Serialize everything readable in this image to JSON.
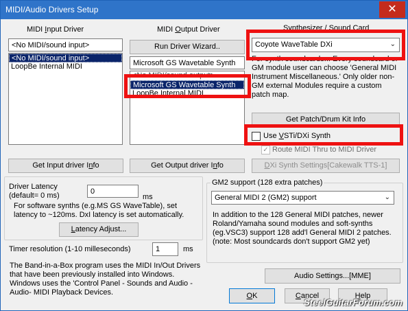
{
  "window": {
    "title": "MIDI/Audio Drivers Setup",
    "close_glyph": "✕"
  },
  "midi_input": {
    "header": "MIDI Input Driver",
    "current_value": "<No MIDI/sound input>",
    "items": [
      "<No MIDI/sound input>",
      "LoopBe Internal MIDI"
    ],
    "selected_index": 0,
    "get_info_button": "Get Input driver Info"
  },
  "midi_output": {
    "header": "MIDI Output Driver",
    "wizard_button": "Run Driver Wizard..",
    "current_value": "Microsoft GS Wavetable Synth",
    "items": [
      "<No MIDI/sound output>",
      "Microsoft GS Wavetable Synth",
      "LoopBe Internal MIDI"
    ],
    "selected_index": 1,
    "get_info_button": "Get Output driver Info"
  },
  "synth": {
    "header": "Synthesizer / Sound Card",
    "selected": "Coyote WaveTable DXi",
    "description": "For synth soundcards... Every soundcard or GM module user can choose 'General MIDI Instrument Miscellaneous.' Only older non-GM external Modules require a custom patch map.",
    "patch_button": "Get Patch/Drum Kit Info",
    "vsti_label": "Use VSTi/DXi Synth",
    "vsti_checked": false,
    "route_label": "Route MIDI Thru to MIDI Driver",
    "route_checked": true,
    "dxi_button": "DXi Synth Settings[Cakewalk TTS-1]"
  },
  "latency": {
    "label_line1": "Driver Latency",
    "label_line2": "(default= 0 ms)",
    "value": "0",
    "unit": "ms",
    "note": "For software synths  (e.g.MS GS WaveTable), set latency to ~120ms. DxI latency is set automatically.",
    "adjust_button": "Latency Adjust..."
  },
  "timer": {
    "label": "Timer resolution (1-10 milleseconds)",
    "value": "1",
    "unit": "ms"
  },
  "info_text": "The Band-in-a-Box program uses the MIDI In/Out Drivers that have been previously installed into Windows. Windows uses the 'Control Panel - Sounds and Audio -Audio- MIDI Playback Devices.",
  "gm2": {
    "group_label": "GM2 support (128 extra patches)",
    "selected": "General MIDI 2 (GM2) support",
    "description": "In addition to the 128 General MIDI patches, newer Roland/Yamaha sound modules and soft-synths (eg.VSC3) support 128 add'l General MIDI 2 patches. (note: Most soundcards don't support GM2 yet)"
  },
  "footer": {
    "audio_settings": "Audio Settings...[MME]",
    "ok": "OK",
    "cancel": "Cancel",
    "help": "Help"
  },
  "watermark": "SteelGuitarForum.com"
}
